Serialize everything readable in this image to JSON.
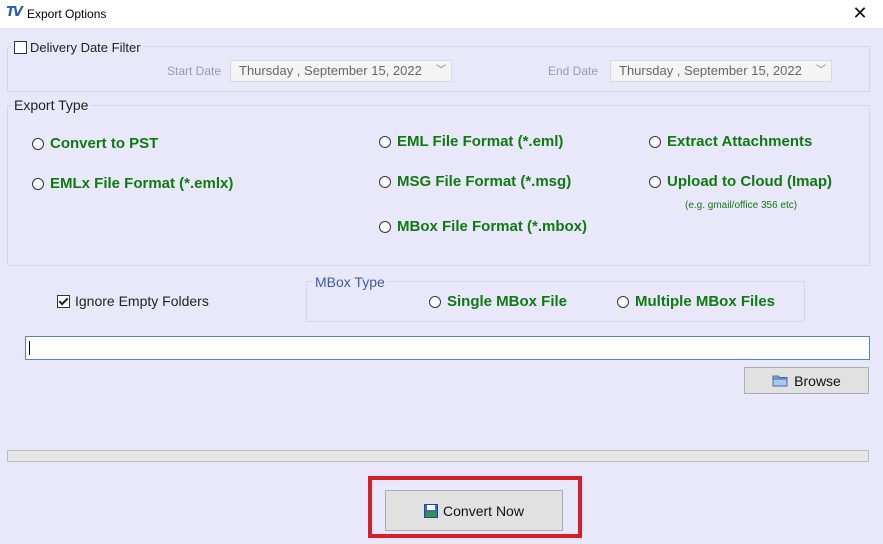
{
  "window": {
    "title": "Export Options",
    "app_icon_text": "TV",
    "close_glyph": "✕"
  },
  "date_filter": {
    "label": "Delivery Date Filter",
    "checked": false,
    "start_label": "Start Date",
    "start_value": "Thursday  , September 15, 2022",
    "end_label": "End Date",
    "end_value": "Thursday  , September 15, 2022"
  },
  "export_type": {
    "legend": "Export Type",
    "options": {
      "pst": "Convert to PST",
      "emlx": "EMLx File  Format (*.emlx)",
      "eml": "EML File  Format (*.eml)",
      "msg": "MSG File Format (*.msg)",
      "mbox": "MBox File Format (*.mbox)",
      "attachments": "Extract Attachments",
      "cloud": "Upload to Cloud (Imap)"
    },
    "cloud_hint": "(e.g. gmail/office 356 etc)"
  },
  "ignore_empty": {
    "label": "Ignore Empty Folders",
    "checked": true
  },
  "mbox_type": {
    "legend": "MBox Type",
    "single": "Single MBox File",
    "multiple": "Multiple MBox Files"
  },
  "path": {
    "value": ""
  },
  "browse": {
    "label": "Browse",
    "icon": "folder-icon"
  },
  "progress": {
    "fraction": 0
  },
  "convert": {
    "label": "Convert Now",
    "icon": "save-disk-icon"
  },
  "colors": {
    "option_text": "#0f7a0f",
    "highlight": "#d3202a",
    "background": "#e9e8fb"
  }
}
